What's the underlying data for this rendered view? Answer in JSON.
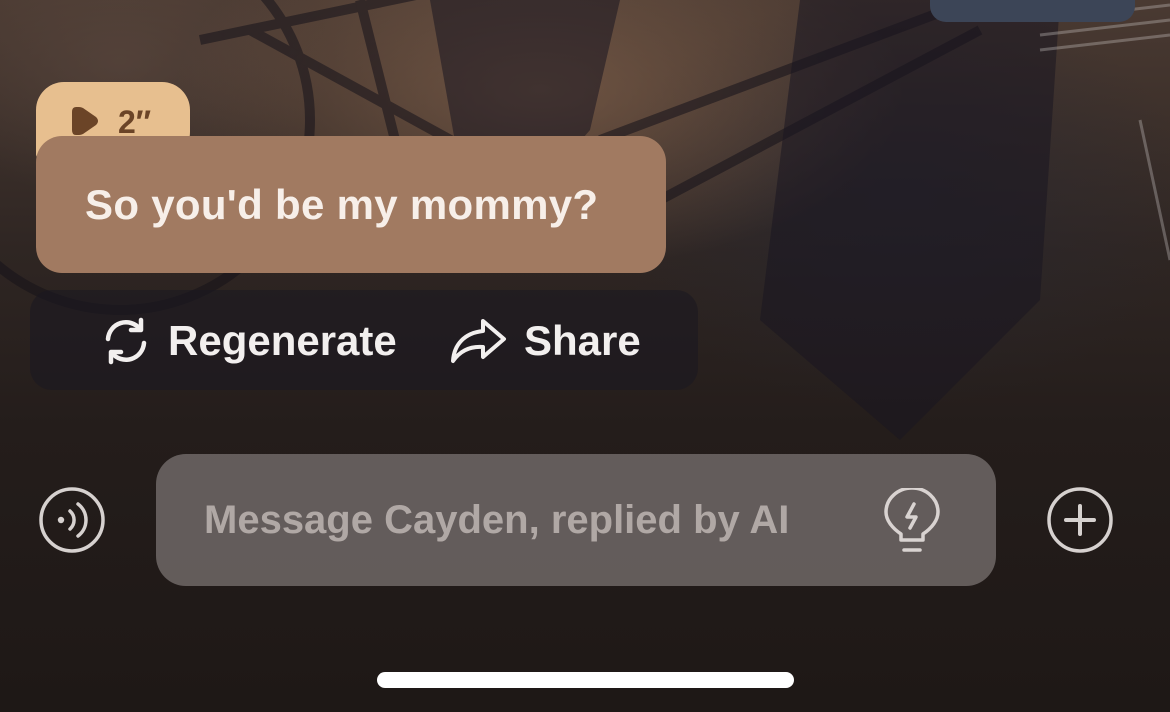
{
  "message": {
    "voice_duration": "2″",
    "text": "So you'd be my mommy?"
  },
  "actions": {
    "regenerate_label": "Regenerate",
    "share_label": "Share"
  },
  "composer": {
    "placeholder": "Message Cayden, replied by AI",
    "value": ""
  },
  "icons": {
    "voice_mode": "voice-waves-icon",
    "play": "play-icon",
    "regenerate": "refresh-icon",
    "share": "share-arrow-icon",
    "hint": "lightbulb-icon",
    "add": "plus-circle-icon"
  },
  "colors": {
    "badge_bg": "#e7bf8f",
    "bubble_bg": "#a17a61",
    "badge_text": "#6b4427",
    "input_bg": "#7d7674"
  }
}
